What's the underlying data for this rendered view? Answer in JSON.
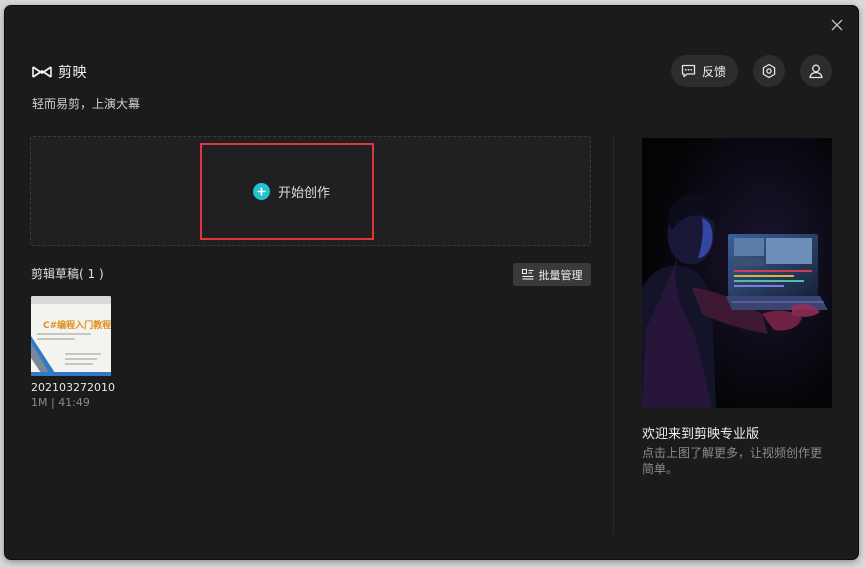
{
  "app": {
    "name": "剪映",
    "slogan": "轻而易剪，上演大幕"
  },
  "header": {
    "feedback_label": "反馈",
    "icons": [
      "feedback-icon",
      "settings-hexagon-icon",
      "user-icon",
      "close-icon"
    ]
  },
  "create": {
    "label": "开始创作",
    "accent": "#21c3cf"
  },
  "drafts": {
    "title": "剪辑草稿( 1 )",
    "batch_label": "批量管理",
    "items": [
      {
        "name": "202103272010",
        "meta": "1M | 41:49",
        "thumb_title": "C#编程入门教程"
      }
    ]
  },
  "promo": {
    "title": "欢迎来到剪映专业版",
    "desc": "点击上图了解更多，让视频创作更简单。"
  },
  "colors": {
    "background": "#1b1b1c",
    "highlight": "#e2353a",
    "button": "#2d2d2f"
  }
}
